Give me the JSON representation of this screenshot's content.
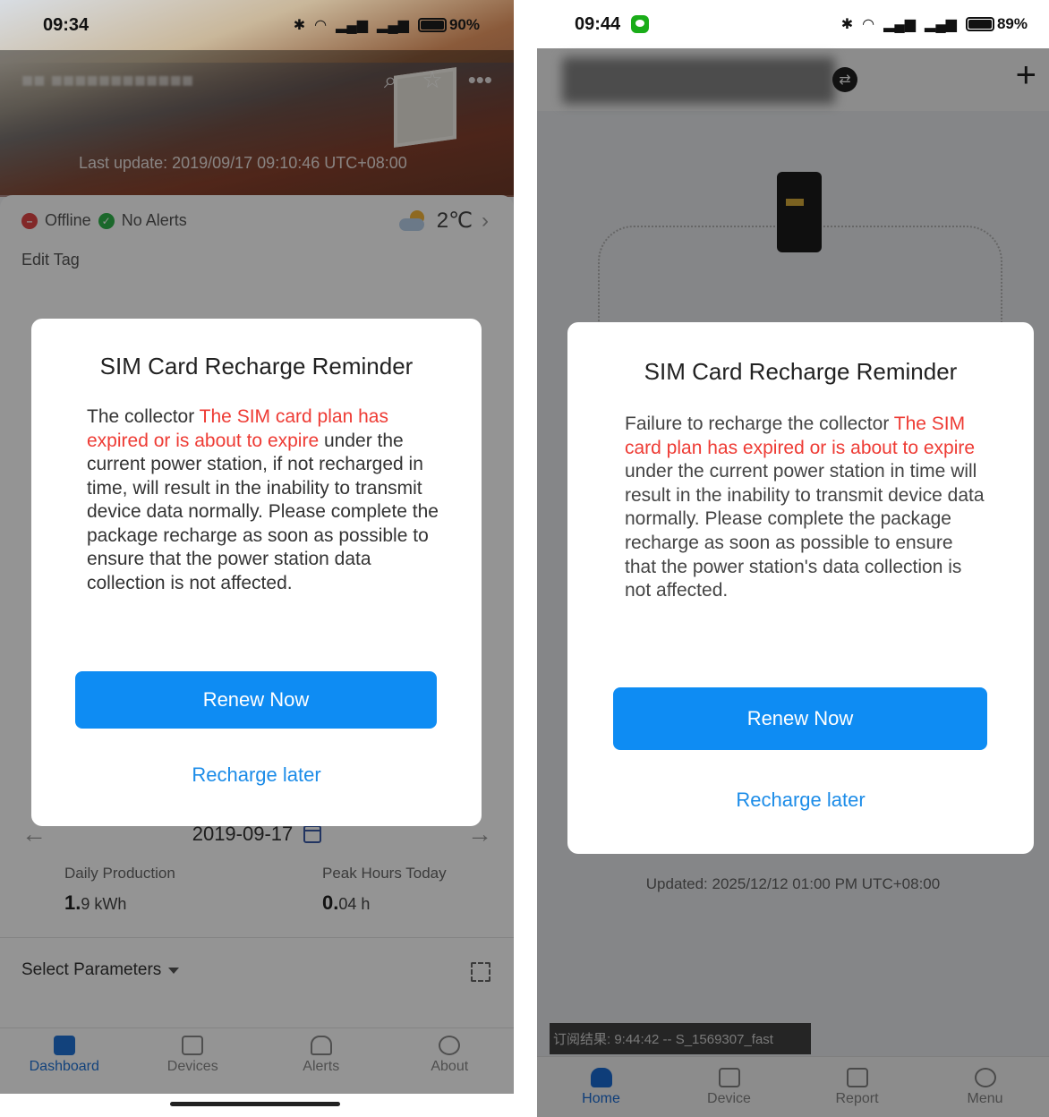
{
  "left": {
    "status_bar": {
      "time": "09:34",
      "battery": "90%"
    },
    "header": {
      "last_update": "Last update: 2019/09/17 09:10:46 UTC+08:00"
    },
    "status": {
      "offline": "Offline",
      "alerts": "No Alerts",
      "temperature": "2℃"
    },
    "edit_tag": "Edit Tag",
    "date": "2019-09-17",
    "stats": [
      {
        "label": "Daily Production",
        "value_main": "1.",
        "value_rest": "9 kWh"
      },
      {
        "label": "Peak Hours Today",
        "value_main": "0.",
        "value_rest": "04 h"
      }
    ],
    "select_parameters": "Select Parameters",
    "tabs": [
      {
        "label": "Dashboard"
      },
      {
        "label": "Devices"
      },
      {
        "label": "Alerts"
      },
      {
        "label": "About"
      }
    ],
    "modal": {
      "title": "SIM Card Recharge Reminder",
      "msg_pre": "The collector ",
      "msg_highlight": "The SIM card plan has expired or is about to expire",
      "msg_post": " under the current power station, if not recharged in time, will result in the inability to transmit device data normally. Please complete the package recharge as soon as possible to ensure that the power station data collection is not affected.",
      "primary_button": "Renew Now",
      "secondary_link": "Recharge later"
    }
  },
  "right": {
    "status_bar": {
      "time": "09:44",
      "battery": "89%"
    },
    "updated": "Updated: 2025/12/12 01:00 PM UTC+08:00",
    "debug_text": "订阅结果: 9:44:42 -- S_1569307_fast",
    "tabs": [
      {
        "label": "Home"
      },
      {
        "label": "Device"
      },
      {
        "label": "Report"
      },
      {
        "label": "Menu"
      }
    ],
    "modal": {
      "title": "SIM Card Recharge Reminder",
      "msg_pre": "Failure to recharge the collector ",
      "msg_highlight": "The SIM card plan has expired or is about to expire",
      "msg_post": " under the current power station in time will result in the inability to transmit device data normally. Please complete the package recharge as soon as possible to ensure that the power station's data collection is not affected.",
      "primary_button": "Renew Now",
      "secondary_link": "Recharge later"
    }
  },
  "colors": {
    "accent": "#0e8cf3",
    "highlight": "#ee3b34",
    "link": "#1c8ce8"
  }
}
